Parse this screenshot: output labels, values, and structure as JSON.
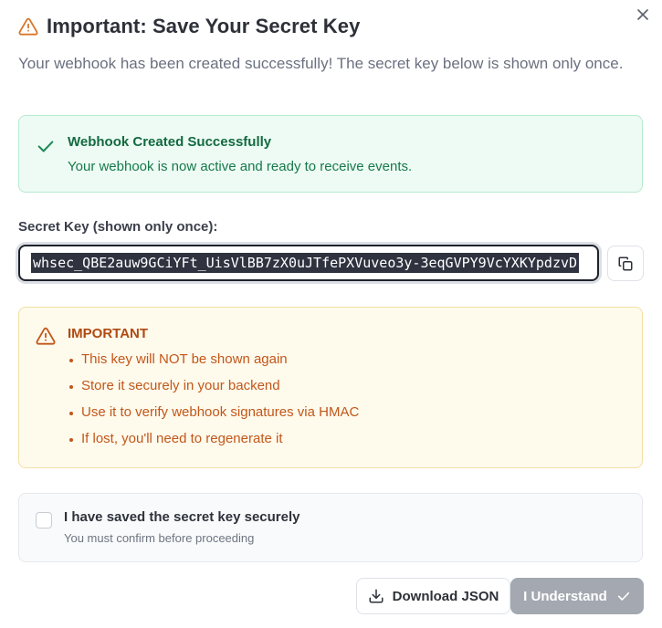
{
  "dialog": {
    "title": "Important: Save Your Secret Key",
    "subtitle": "Your webhook has been created successfully! The secret key below is shown only once.",
    "close_icon": "close-icon"
  },
  "success": {
    "title": "Webhook Created Successfully",
    "text": "Your webhook is now active and ready to receive events.",
    "icon": "check-icon",
    "color": "#136a40"
  },
  "secret": {
    "label": "Secret Key (shown only once):",
    "value": "whsec_QBE2auw9GCiYFt_UisVlBB7zX0uJTfePXVuveo3y-3eqGVPY9VcYXKYpdzvD",
    "copy_icon": "copy-icon"
  },
  "warning": {
    "title": "IMPORTANT",
    "icon": "warning-triangle-icon",
    "color": "#b04a12",
    "items": [
      "This key will NOT be shown again",
      "Store it securely in your backend",
      "Use it to verify webhook signatures via HMAC",
      "If lost, you'll need to regenerate it"
    ]
  },
  "confirm": {
    "label": "I have saved the secret key securely",
    "hint": "You must confirm before proceeding",
    "checked": false
  },
  "actions": {
    "download_label": "Download JSON",
    "download_icon": "download-icon",
    "understand_label": "I Understand",
    "understand_icon": "check-icon",
    "understand_disabled": true
  }
}
